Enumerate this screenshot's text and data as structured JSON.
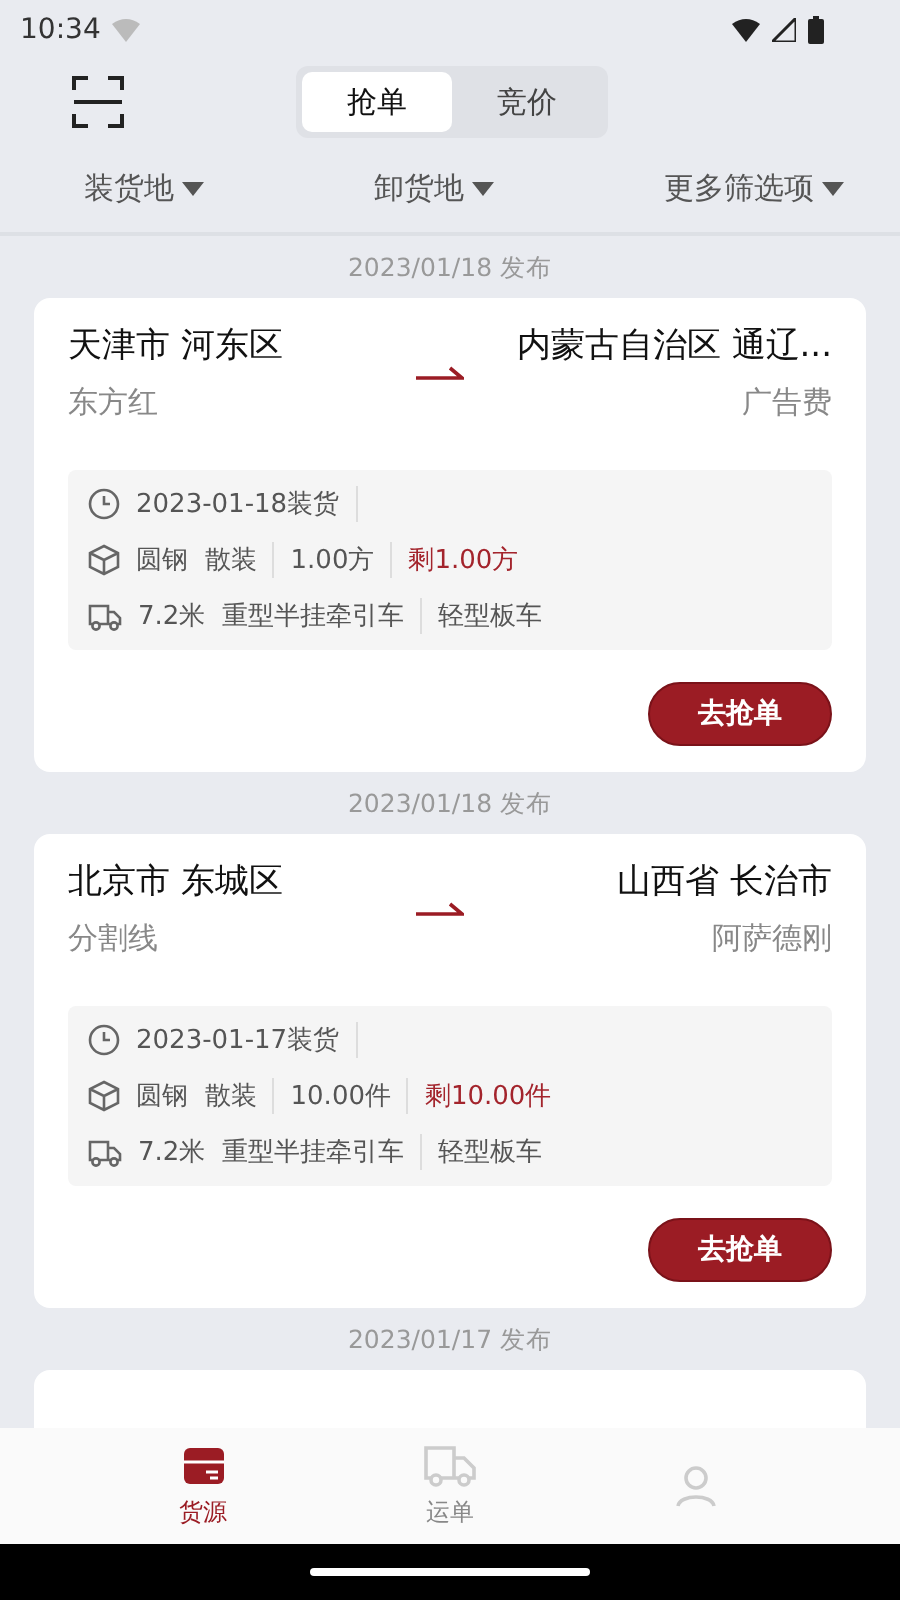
{
  "status_bar": {
    "time": "10:34"
  },
  "tabs": [
    {
      "label": "抢单",
      "selected": true
    },
    {
      "label": "竞价",
      "selected": false
    }
  ],
  "filters": [
    {
      "label": "装货地"
    },
    {
      "label": "卸货地"
    },
    {
      "label": "更多筛选项"
    }
  ],
  "orders": [
    {
      "published": "2023/01/18 发布",
      "from": "天津市 河东区",
      "from_sub": "东方红",
      "to": "内蒙古自治区 通辽...",
      "to_sub": "广告费",
      "load_date": "2023-01-18装货",
      "goods": "圆钢  散装",
      "amount": "1.00方",
      "remaining": "剩1.00方",
      "truck": "7.2米  重型半挂牵引车",
      "truck_type": "轻型板车",
      "action": "去抢单"
    },
    {
      "published": "2023/01/18 发布",
      "from": "北京市 东城区",
      "from_sub": "分割线",
      "to": "山西省 长治市",
      "to_sub": "阿萨德刚",
      "load_date": "2023-01-17装货",
      "goods": "圆钢  散装",
      "amount": "10.00件",
      "remaining": "剩10.00件",
      "truck": "7.2米  重型半挂牵引车",
      "truck_type": "轻型板车",
      "action": "去抢单"
    },
    {
      "published": "2023/01/17 发布"
    }
  ],
  "nav": [
    {
      "kind": "cargo",
      "label": "货源",
      "selected": true
    },
    {
      "kind": "truck",
      "label": "运单",
      "selected": false
    },
    {
      "kind": "person",
      "selected": false
    }
  ]
}
